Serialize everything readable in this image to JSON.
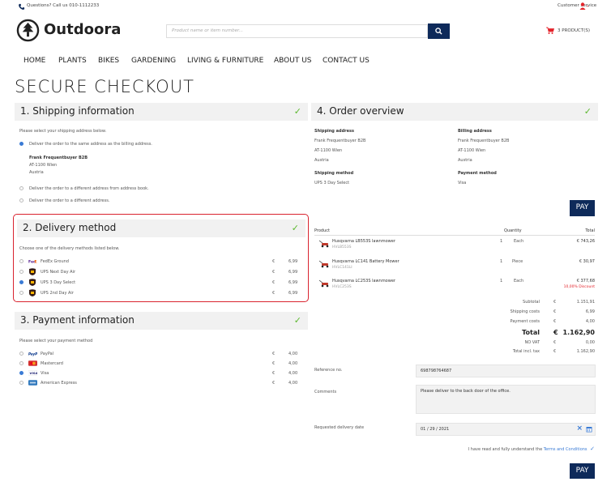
{
  "topbar": {
    "questions": "Questions? Call us 010-1112233",
    "customer_service": "Customer service"
  },
  "brand": {
    "name": "Outdoora"
  },
  "search": {
    "placeholder": "Product name or item number..."
  },
  "cart": {
    "label": "3 PRODUCT(S)"
  },
  "nav": [
    "HOME",
    "PLANTS",
    "BIKES",
    "GARDENING",
    "LIVING & FURNITURE",
    "ABOUT US",
    "CONTACT US"
  ],
  "page_title": "SECURE CHECKOUT",
  "shipping": {
    "title": "1. Shipping information",
    "intro": "Please select your shipping address below.",
    "opt1": "Deliver the order to the same address as the billing address.",
    "name": "Frank Frequentbuyer B2B",
    "city": "AT-1100 Wien",
    "country": "Austria",
    "opt2": "Deliver the order to a different address from address book.",
    "opt3": "Deliver the order to a different address."
  },
  "delivery": {
    "title": "2. Delivery method",
    "intro": "Choose one of the delivery methods listed below.",
    "methods": [
      {
        "label": "FedEx Ground",
        "cur": "€",
        "price": "6,99"
      },
      {
        "label": "UPS Next Day Air",
        "cur": "€",
        "price": "6,99"
      },
      {
        "label": "UPS 3 Day Select",
        "cur": "€",
        "price": "6,99"
      },
      {
        "label": "UPS 2nd Day Air",
        "cur": "€",
        "price": "6,99"
      }
    ],
    "selected": 2
  },
  "payment": {
    "title": "3. Payment information",
    "intro": "Please select your payment method",
    "methods": [
      {
        "label": "PayPal",
        "cur": "€",
        "price": "4,00"
      },
      {
        "label": "Mastercard",
        "cur": "€",
        "price": "4,00"
      },
      {
        "label": "Visa",
        "cur": "€",
        "price": "4,00"
      },
      {
        "label": "American Express",
        "cur": "€",
        "price": "4,00"
      }
    ],
    "selected": 2
  },
  "overview": {
    "title": "4. Order overview",
    "shipping_address_label": "Shipping address",
    "shipping_address": [
      "Frank Frequentbuyer B2B",
      "AT-1100 Wien",
      "Austria"
    ],
    "billing_address_label": "Billing address",
    "billing_address": [
      "Frank Frequentbuyer B2B",
      "AT-1100 Wien",
      "Austria"
    ],
    "shipping_method_label": "Shipping method",
    "shipping_method": "UPS 3 Day Select",
    "payment_method_label": "Payment method",
    "payment_method": "Visa",
    "pay_label": "PAY"
  },
  "cart_table": {
    "headers": {
      "product": "Product",
      "quantity": "Quantity",
      "total": "Total"
    },
    "rows": [
      {
        "name": "Husqvarna LB553S lawnmower",
        "sku": "HVLB553S",
        "qty": "1",
        "unit": "Each",
        "total": "€ 743,26",
        "discount": ""
      },
      {
        "name": "Husqvarna LC141 Battery Mower",
        "sku": "HVLC141LI",
        "qty": "1",
        "unit": "Piece",
        "total": "€ 30,97",
        "discount": ""
      },
      {
        "name": "Husqvarna LC253S lawnmower",
        "sku": "HVLC253S",
        "qty": "1",
        "unit": "Each",
        "total": "€ 377,68",
        "discount": "10,00% Discount"
      }
    ]
  },
  "totals": [
    {
      "label": "Subtotal",
      "cur": "€",
      "value": "1.151,91",
      "bold": false
    },
    {
      "label": "Shipping costs",
      "cur": "€",
      "value": "6,99",
      "bold": false
    },
    {
      "label": "Payment costs",
      "cur": "€",
      "value": "4,00",
      "bold": false
    },
    {
      "label": "Total",
      "cur": "€",
      "value": "1.162,90",
      "bold": true
    },
    {
      "label": "NO VAT",
      "cur": "€",
      "value": "0,00",
      "bold": false
    },
    {
      "label": "Total incl. tax",
      "cur": "€",
      "value": "1.162,90",
      "bold": false
    }
  ],
  "form": {
    "reference_label": "Reference no.",
    "reference_value": "698798764687",
    "comments_label": "Comments",
    "comments_value": "Please deliver to the back door of the office.",
    "date_label": "Requested delivery date",
    "date_value": "01 / 29 / 2021",
    "terms_prefix": "I have read and fully understand the ",
    "terms_link": "Terms and Conditions",
    "pay_label": "PAY"
  },
  "colors": {
    "accent": "#0e2a5a",
    "check": "#5cb82e",
    "highlight": "#d9232f",
    "discount": "#e4232b",
    "link": "#3a7bd5"
  }
}
